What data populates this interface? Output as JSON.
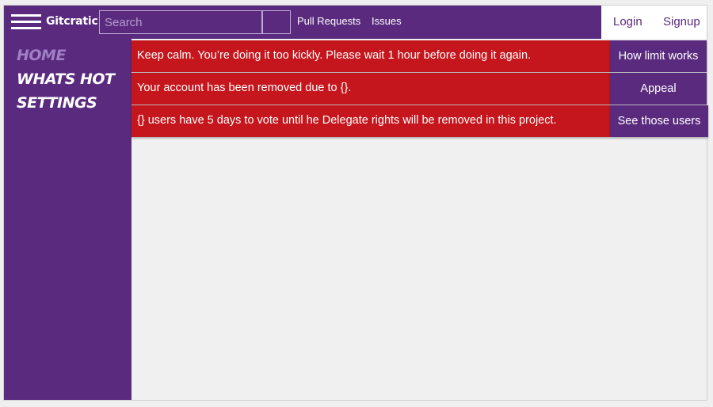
{
  "header": {
    "brand": "Gitcratic",
    "search_placeholder": "Search",
    "nav": {
      "pull_requests": "Pull Requests",
      "issues": "Issues"
    },
    "auth": {
      "login": "Login",
      "signup": "Signup"
    }
  },
  "sidebar": {
    "items": [
      {
        "label": "HOME",
        "state": "active"
      },
      {
        "label": "WHATS HOT"
      },
      {
        "label": "SETTINGS"
      }
    ]
  },
  "alerts": [
    {
      "message": "Keep calm. You’re doing it too kickly. Please wait 1 hour before doing it again.",
      "action": "How limit works"
    },
    {
      "message": "Your account has been removed due to {}.",
      "action": "Appeal"
    },
    {
      "message": "{} users have 5 days to vote until he Delegate rights will be removed in this project.",
      "action": "See those users"
    }
  ],
  "colors": {
    "brand_purple": "#5a2a7e",
    "alert_red": "#c4161c",
    "active_sidebar_text": "#a07fc4",
    "content_background": "#f0f0f0"
  },
  "icons": {
    "menu": "hamburger-menu-icon"
  }
}
